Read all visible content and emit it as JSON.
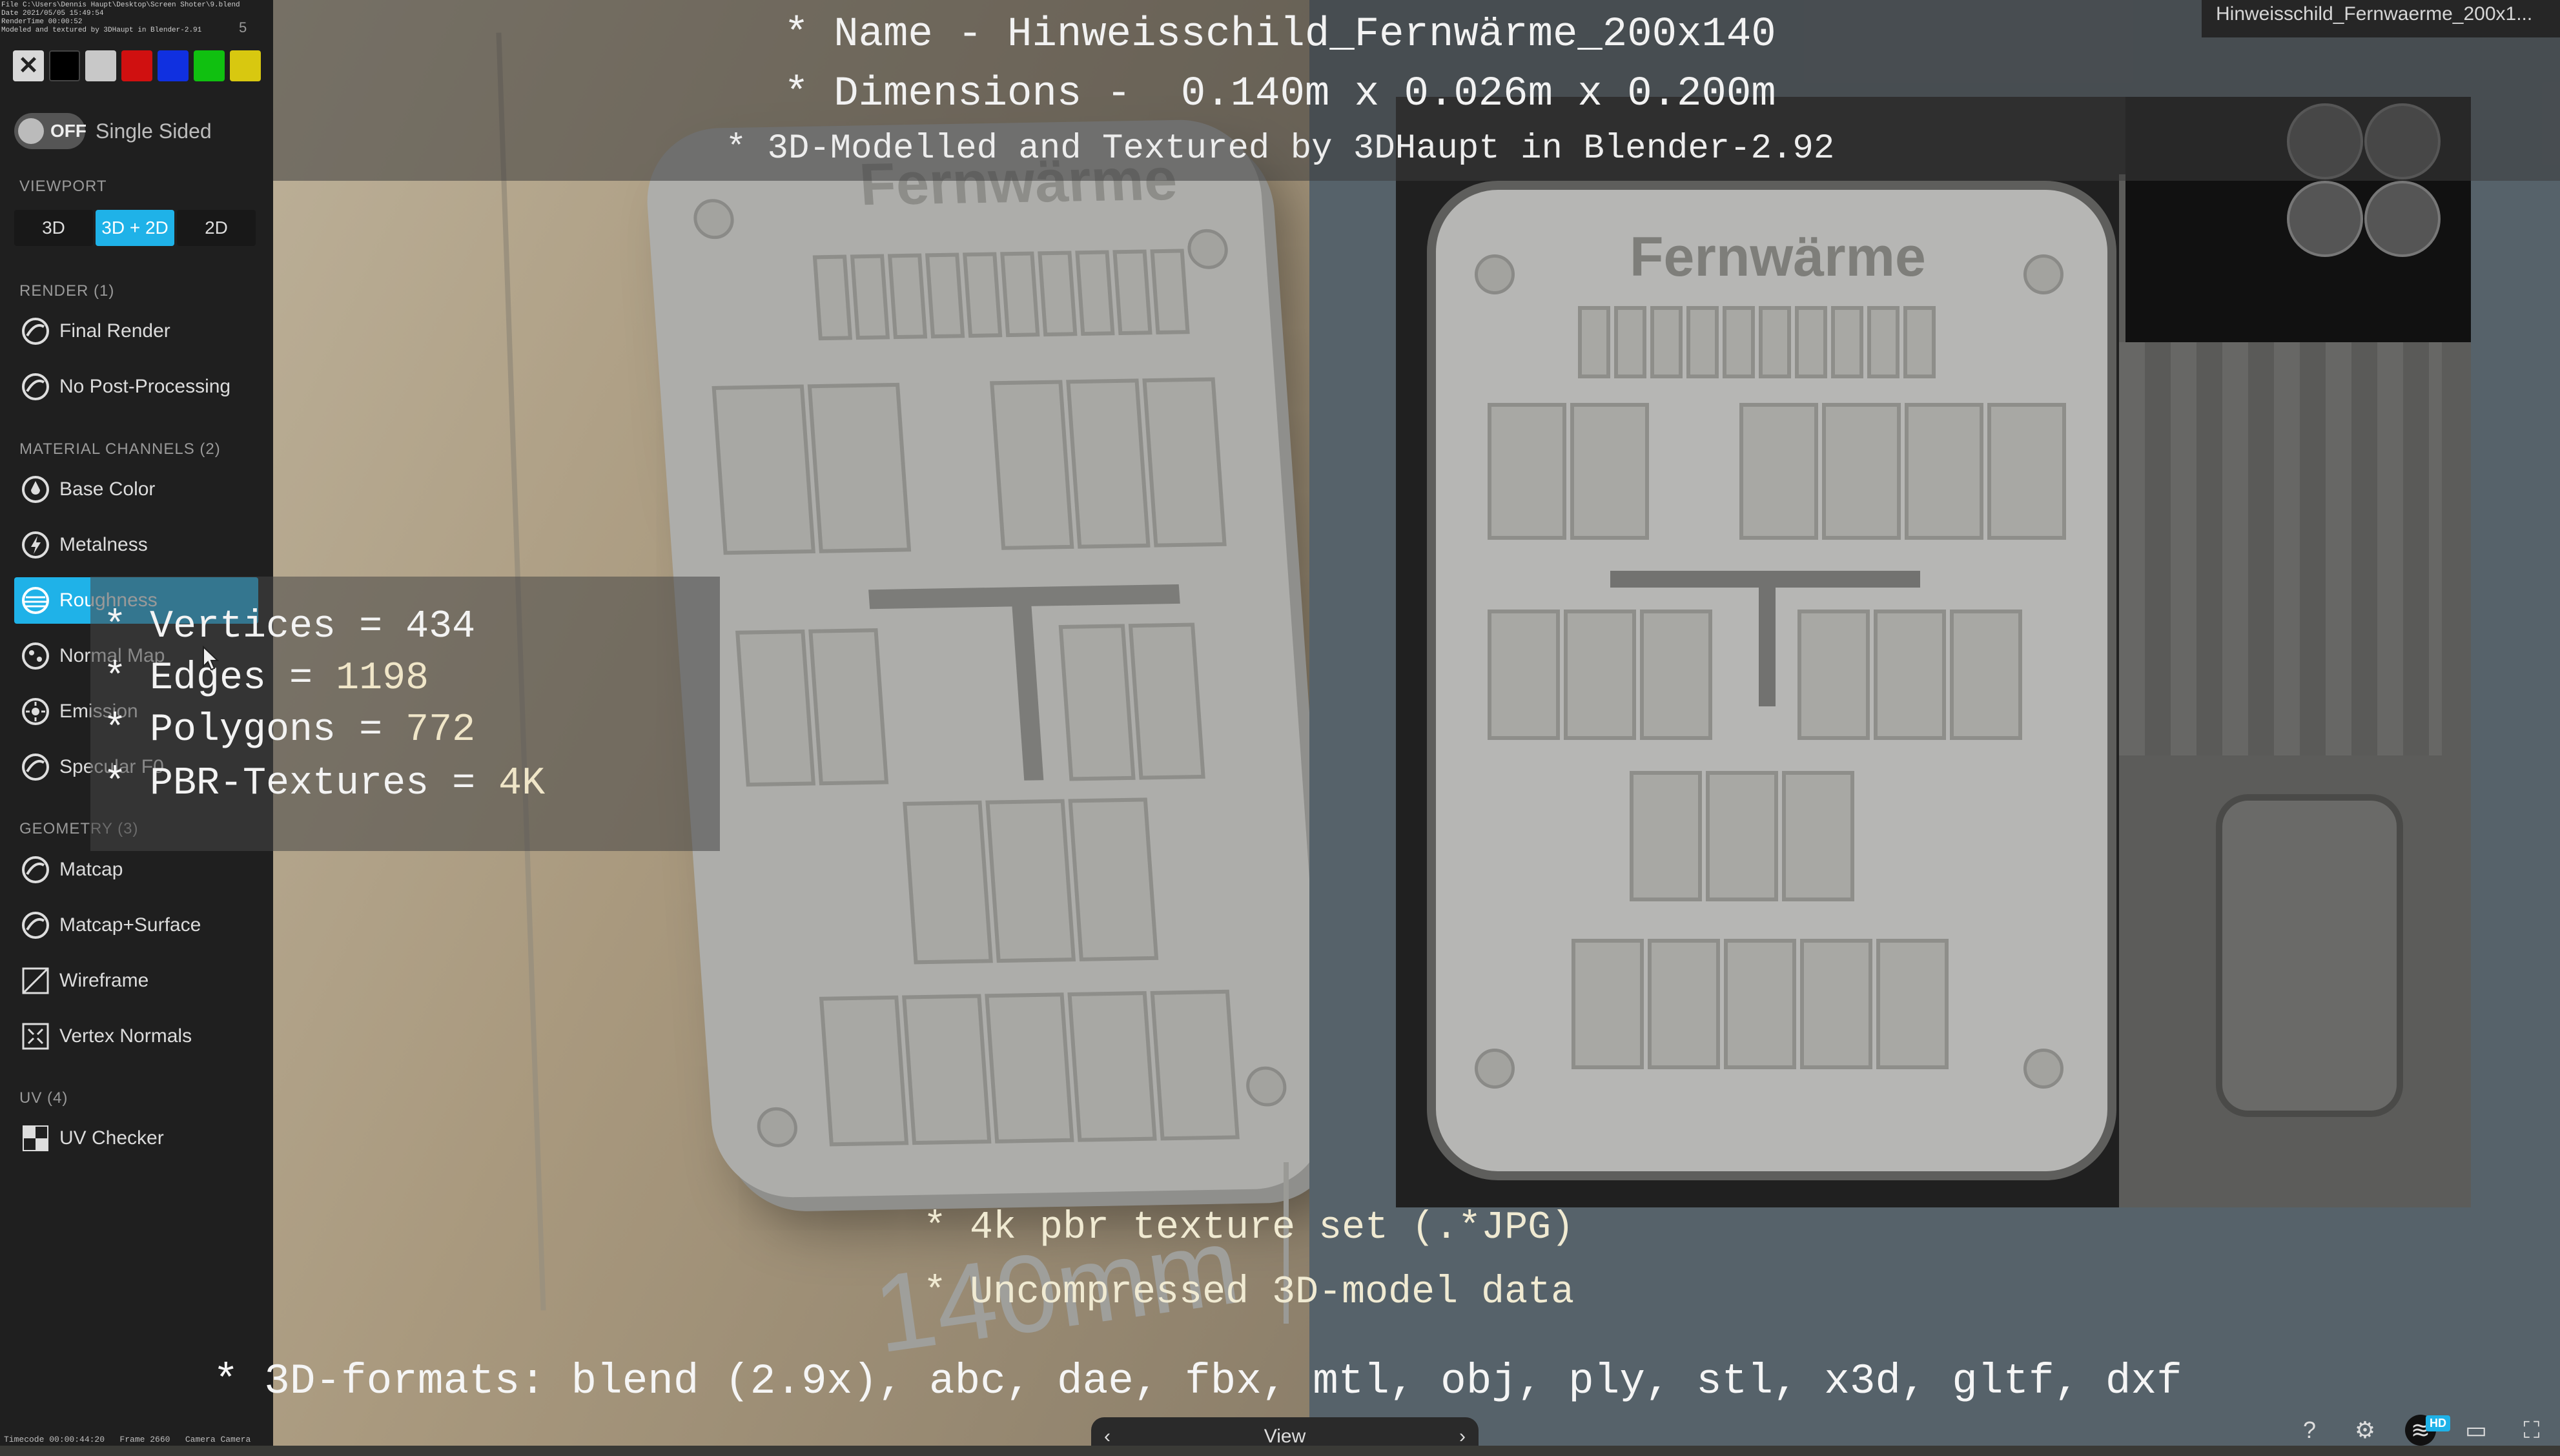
{
  "overlay": {
    "name_line": "* Name - Hinweisschild_Fernwärme_200x140",
    "dims_line": "* Dimensions -  0.140m x 0.026m x 0.200m",
    "credit_line": "* 3D-Modelled and Textured by 3DHaupt in Blender-2.92",
    "stats": [
      {
        "label": "* Vertices = ",
        "value": "434"
      },
      {
        "label": "* Edges = ",
        "value": "1198"
      },
      {
        "label": "* Polygons = ",
        "value": "772"
      },
      {
        "label": "* PBR-Textures = ",
        "value": "4K"
      }
    ],
    "bottom_1": "* 4k pbr texture set (.*JPG)",
    "bottom_2": "* Uncompressed 3D-model data",
    "bottom_3": "* 3D-formats: blend (2.9x), abc, dae, fbx, mtl, obj, ply, stl, x3d, gltf, dxf"
  },
  "sign": {
    "title": "Fernwärme",
    "dimension_label": "140mm"
  },
  "sidebar": {
    "file_info": "File C:\\Users\\Dennis Haupt\\Desktop\\Screen Shoter\\9.blend\nDate 2021/05/05 15:49:54\nRenderTime 00:00:52\nModeled and textured by 3DHaupt in Blender-2.91",
    "file_page": "5",
    "swatches": [
      "#000000",
      "#c8c8c8",
      "#d01010",
      "#1030e0",
      "#10c010",
      "#d8c810"
    ],
    "toggle_text": "OFF",
    "single_sided_label": "Single Sided",
    "viewport_label": "VIEWPORT",
    "viewport_modes": [
      "3D",
      "3D + 2D",
      "2D"
    ],
    "render_label": "RENDER (1)",
    "render_items": [
      "Final Render",
      "No Post-Processing"
    ],
    "material_label": "MATERIAL CHANNELS (2)",
    "material_items": [
      "Base Color",
      "Metalness",
      "Roughness",
      "Normal Map",
      "Emission",
      "Specular F0"
    ],
    "geometry_label": "GEOMETRY (3)",
    "geometry_items": [
      "Matcap",
      "Matcap+Surface",
      "Wireframe",
      "Vertex Normals"
    ],
    "uv_label": "UV (4)",
    "uv_items": [
      "UV Checker"
    ]
  },
  "header": {
    "model_tab": "Hinweisschild_Fernwaerme_200x1..."
  },
  "view_bar": {
    "label": "View"
  },
  "status_bar": "Timecode 00:00:44:20   Frame 2660   Camera Camera",
  "colors": {
    "accent": "#1fb2e8",
    "sidebar_bg": "#1f1f1f"
  }
}
